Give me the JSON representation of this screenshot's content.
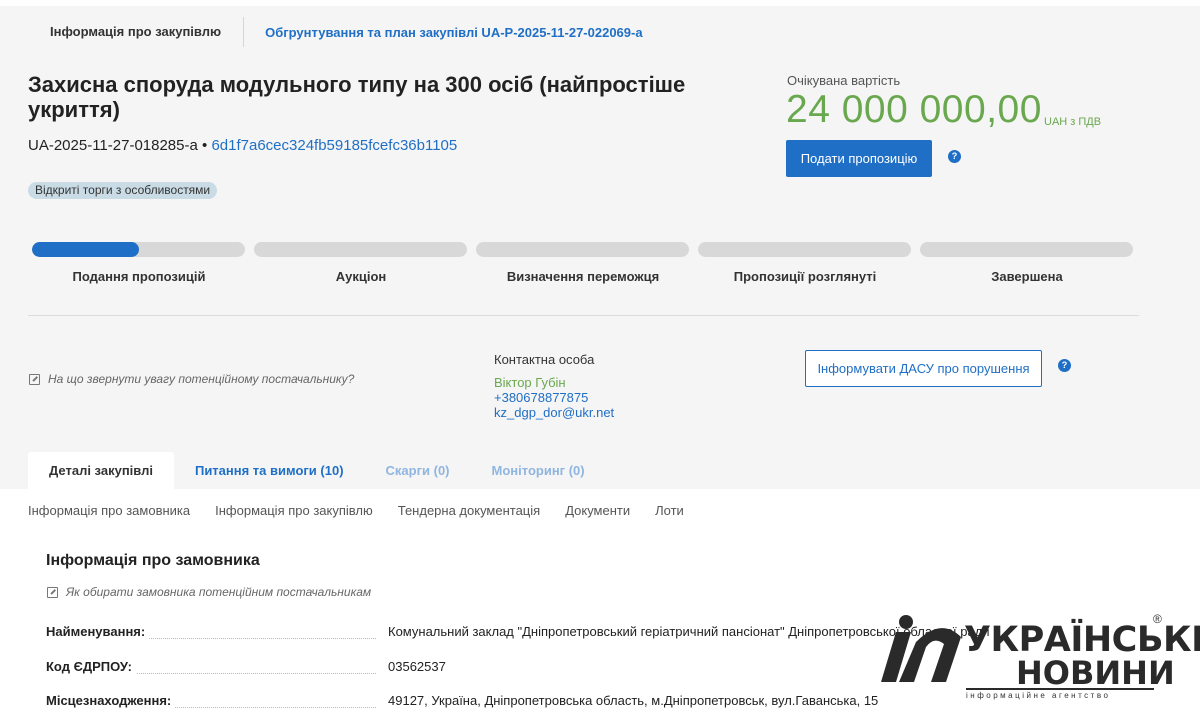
{
  "top_tabs": {
    "active": "Інформація про закупівлю",
    "link": "Обгрунтування та план закупівлі UA-P-2025-11-27-022069-a"
  },
  "tender": {
    "title": "Захисна споруда модульного типу на 300 осіб (найпростіше укриття)",
    "id": "UA-2025-11-27-018285-a",
    "separator": "•",
    "hash": "6d1f7a6cec324fb59185fcefc36b1105",
    "badge": "Відкриті торги з особливостями"
  },
  "expected": {
    "label": "Очікувана вартість",
    "value": "24 000 000,00",
    "currency": "UAH з ПДВ",
    "offer_button": "Подати пропозицію",
    "help_icon": "question-circle-icon"
  },
  "progress": {
    "stages": [
      {
        "label": "Подання пропозицій",
        "fill": 0.5
      },
      {
        "label": "Аукціон",
        "fill": 0
      },
      {
        "label": "Визначення переможця",
        "fill": 0
      },
      {
        "label": "Пропозиції розглянуті",
        "fill": 0
      },
      {
        "label": "Завершена",
        "fill": 0
      }
    ]
  },
  "hint": {
    "text": "На що звернути увагу потенційному постачальнику?",
    "icon": "external-link-icon"
  },
  "contact": {
    "title": "Контактна особа",
    "name": "Віктор Губін",
    "phone": "+380678877875",
    "email": "kz_dgp_dor@ukr.net"
  },
  "dasu_button": "Інформувати ДАСУ про порушення",
  "tabs": [
    {
      "label": "Деталі закупівлі"
    },
    {
      "label": "Питання та вимоги (10)"
    },
    {
      "label": "Скарги (0)"
    },
    {
      "label": "Моніторинг (0)"
    }
  ],
  "subnav": [
    "Інформація про замовника",
    "Інформація про закупівлю",
    "Тендерна документація",
    "Документи",
    "Лоти"
  ],
  "customer": {
    "title": "Інформація про замовника",
    "hint": "Як обирати замовника потенційним постачальникам",
    "rows": [
      {
        "key": "Найменування:",
        "value": "Комунальний заклад \"Дніпропетровський геріатричний пансіонат\" Дніпропетровської обласної ради"
      },
      {
        "key": "Код ЄДРПОУ:",
        "value": "03562537"
      },
      {
        "key": "Місцезнаходження:",
        "value": "49127, Україна, Дніпропетровська область, м.Дніпропетровськ, вул.Гаванська, 15"
      }
    ]
  },
  "watermark": {
    "line1": "УКРАЇНСЬКІ",
    "line2": "НОВИНИ",
    "sub": "інформаційне агентство",
    "reg": "®"
  },
  "colors": {
    "accent": "#1f6fc6",
    "value_green": "#6aa84f",
    "panel_bg": "#f5f5f5"
  }
}
